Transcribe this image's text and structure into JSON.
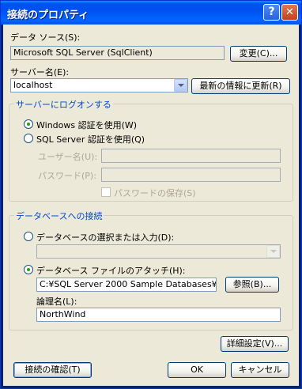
{
  "window": {
    "title": "接続のプロパティ",
    "help_glyph": "?",
    "close_glyph": "✕"
  },
  "data_source": {
    "label": "データ ソース(S):",
    "value": "Microsoft SQL Server (SqlClient)",
    "change_button": "変更(C)..."
  },
  "server": {
    "label": "サーバー名(E):",
    "value": "localhost",
    "refresh_button": "最新の情報に更新(R)"
  },
  "logon": {
    "group_title": "サーバーにログオンする",
    "windows_auth": "Windows 認証を使用(W)",
    "sql_auth": "SQL Server 認証を使用(Q)",
    "selected": "windows",
    "username_label": "ユーザー名(U):",
    "password_label": "パスワード(P):",
    "save_password": "パスワードの保存(S)"
  },
  "database": {
    "group_title": "データベースへの接続",
    "select_option": "データベースの選択または入力(D):",
    "attach_option": "データベース ファイルのアタッチ(H):",
    "selected": "attach",
    "file_path": "C:¥SQL Server 2000 Sample Databases¥NC",
    "browse_button": "参照(B)...",
    "logical_name_label": "論理名(L):",
    "logical_name_value": "NorthWind"
  },
  "buttons": {
    "advanced": "詳細設定(V)...",
    "test_connection": "接続の確認(T)",
    "ok": "OK",
    "cancel": "キャンセル"
  }
}
